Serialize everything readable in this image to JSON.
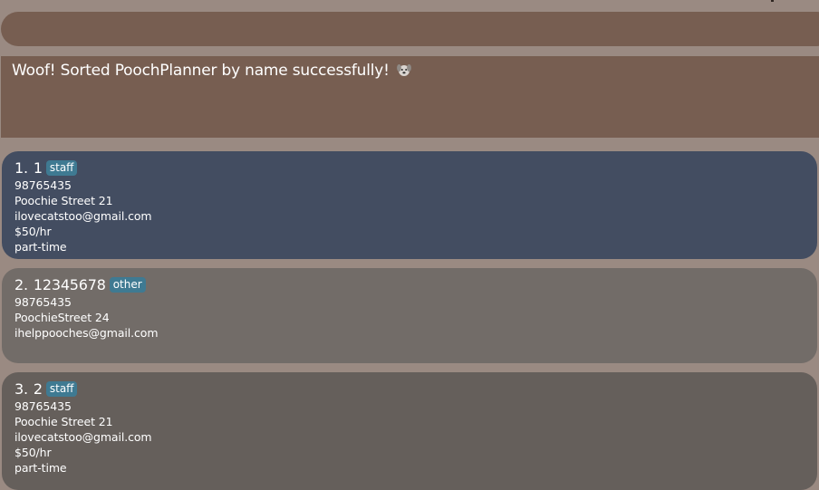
{
  "command_box": {
    "value": ""
  },
  "result": {
    "message": "Woof! Sorted PoochPlanner by name successfully!",
    "emoji_icon": "dog-icon"
  },
  "persons": [
    {
      "index": "1.",
      "name": "1",
      "tag": "staff",
      "phone": "98765435",
      "address": "Poochie Street 21",
      "email": "ilovecatstoo@gmail.com",
      "salary": "$50/hr",
      "employment": "part-time"
    },
    {
      "index": "2.",
      "name": "12345678",
      "tag": "other",
      "phone": "98765435",
      "address": "PoochieStreet 24",
      "email": "ihelppooches@gmail.com"
    },
    {
      "index": "3.",
      "name": "2",
      "tag": "staff",
      "phone": "98765435",
      "address": "Poochie Street 21",
      "email": "ilovecatstoo@gmail.com",
      "salary": "$50/hr",
      "employment": "part-time"
    }
  ],
  "colors": {
    "background": "#9a8a82",
    "command_box": "#775e51",
    "result_box": "#775e51",
    "card_selected": "#434d61",
    "card_even": "#726c68",
    "card_odd": "#655f5b",
    "tag": "#3f7a92"
  }
}
